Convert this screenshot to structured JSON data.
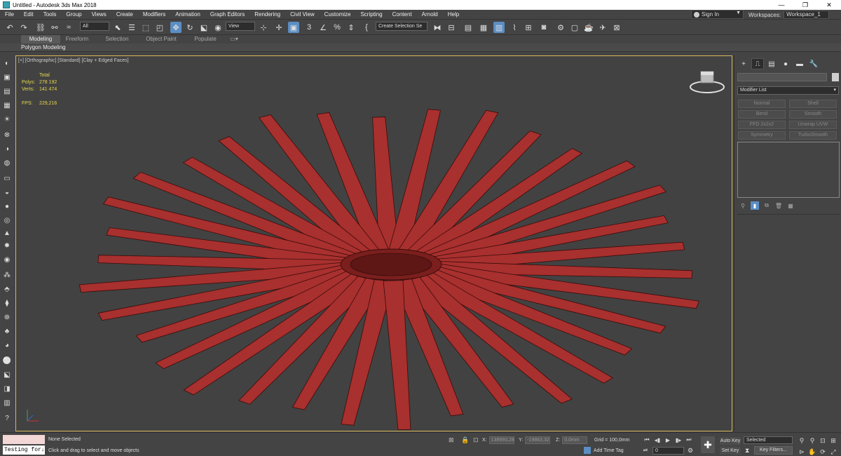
{
  "window": {
    "title": "Untitled - Autodesk 3ds Max 2018",
    "minimize": "—",
    "maximize": "❐",
    "close": "✕"
  },
  "menu": [
    "File",
    "Edit",
    "Tools",
    "Group",
    "Views",
    "Create",
    "Modifiers",
    "Animation",
    "Graph Editors",
    "Rendering",
    "Civil View",
    "Customize",
    "Scripting",
    "Content",
    "Arnold",
    "Help"
  ],
  "signin": {
    "label": "Sign In"
  },
  "workspaces": {
    "label": "Workspaces:",
    "value": "Workspace_1"
  },
  "toolbar": {
    "selection_filter": "All",
    "ref_coord": "View",
    "named_selection": "Create Selection Se"
  },
  "ribbon": {
    "tabs": [
      "Modeling",
      "Freeform",
      "Selection",
      "Object Paint",
      "Populate"
    ],
    "active_tab": "Modeling",
    "panel_label": "Polygon Modeling"
  },
  "viewport": {
    "label": "[+] [Orthographic] [Standard] [Clay + Edged Faces]",
    "stats_total_label": "Total",
    "polys_label": "Polys:",
    "polys_value": "278 192",
    "verts_label": "Verts:",
    "verts_value": "141 474",
    "fps_label": "FPS:",
    "fps_value": "229,216",
    "model_color": "#a8302e",
    "border_color": "#d6b85a"
  },
  "command_panel": {
    "modifier_list": "Modifier List",
    "modifier_buttons": [
      "Normal",
      "Shell",
      "Bend",
      "Smooth",
      "FFD 2x2x2",
      "Unwrap UVW",
      "Symmetry",
      "TurboSmooth"
    ]
  },
  "status": {
    "maxscript_listener": "Testing for↓",
    "selection": "None Selected",
    "prompt": "Click and drag to select and move objects",
    "x_label": "X:",
    "x_value": "138993,28",
    "y_label": "Y:",
    "y_value": "-19863,32",
    "z_label": "Z:",
    "z_value": "0,0mm",
    "grid": "Grid = 100,0mm",
    "add_time_tag": "Add Time Tag",
    "frame": "0",
    "auto_key": "Auto Key",
    "set_key": "Set Key",
    "key_selection": "Selected",
    "key_filters": "Key Filters..."
  }
}
